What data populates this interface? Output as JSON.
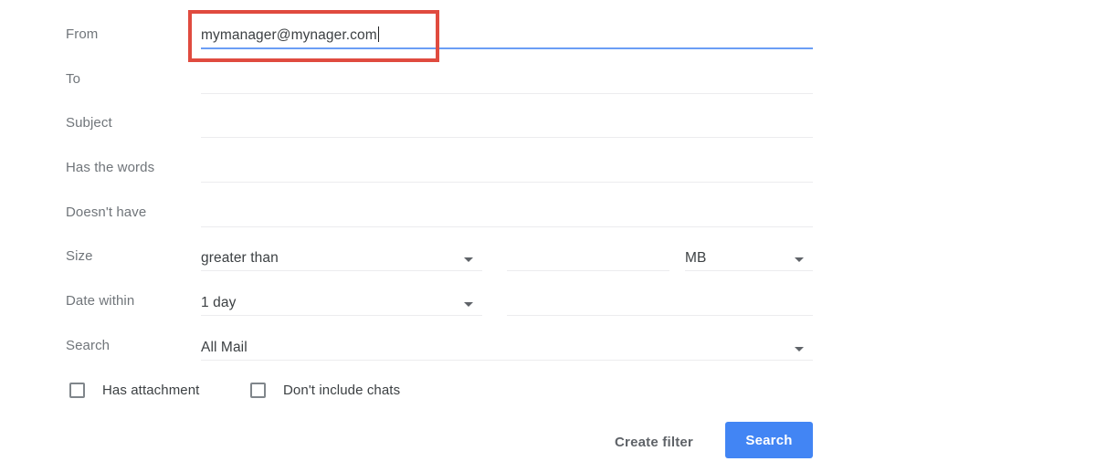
{
  "panel": {
    "name": "gmail-advanced-search-form"
  },
  "fields": [
    {
      "label": "From",
      "value": "mymanager@mynager.com",
      "focused": true
    },
    {
      "label": "To",
      "value": "",
      "focused": false
    },
    {
      "label": "Subject",
      "value": "",
      "focused": false
    },
    {
      "label": "Has the words",
      "value": "",
      "focused": false
    },
    {
      "label": "Doesn't have",
      "value": "",
      "focused": false
    }
  ],
  "size_row": {
    "label": "Size",
    "operator": "greater than",
    "amount": "",
    "unit": "MB"
  },
  "date_row": {
    "label": "Date within",
    "within": "1 day",
    "date": ""
  },
  "search_row": {
    "label": "Search",
    "scope": "All Mail"
  },
  "checkboxes": [
    {
      "label": "Has attachment",
      "checked": false
    },
    {
      "label": "Don't include chats",
      "checked": false
    }
  ],
  "buttons": {
    "create_filter": "Create filter",
    "search": "Search"
  },
  "colors": {
    "accent_blue": "#4285f4",
    "focus_underline": "#6b9ef5",
    "annotation_red": "#e04b3f",
    "label_gray": "#70757a",
    "text_gray": "#3c4043",
    "line_gray": "#ececee"
  }
}
